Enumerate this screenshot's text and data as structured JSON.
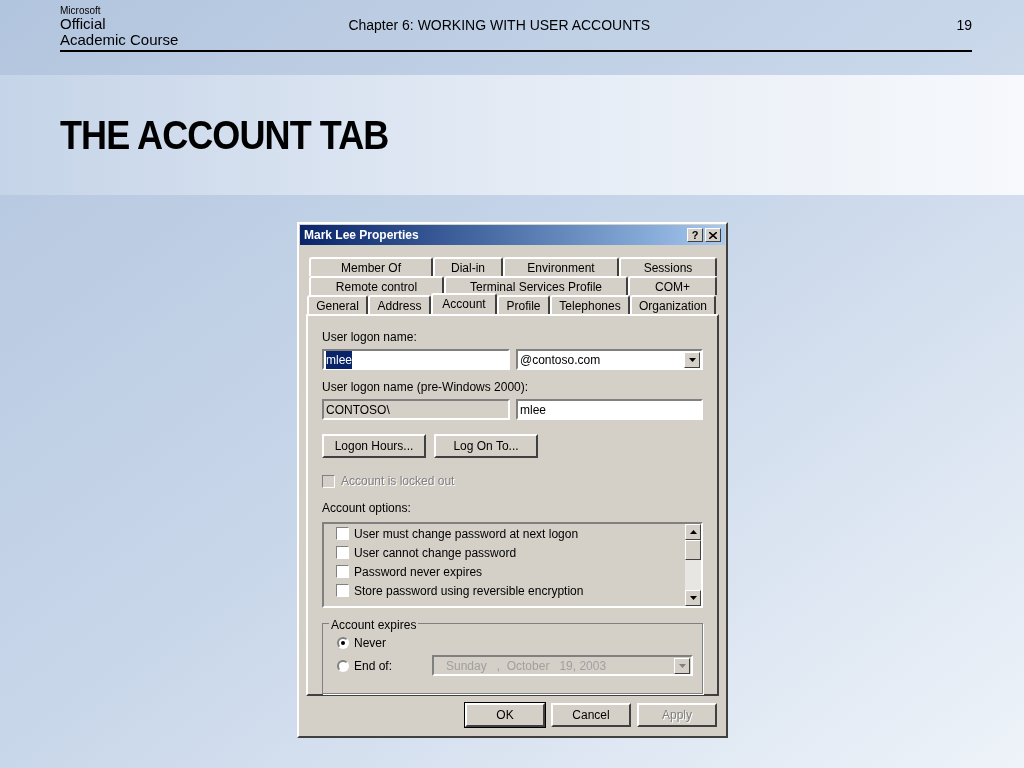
{
  "slide": {
    "logo": {
      "brand": "Microsoft",
      "line1": "Official",
      "line2": "Academic Course"
    },
    "header": "Chapter 6: WORKING WITH USER ACCOUNTS",
    "page": "19",
    "title": "THE ACCOUNT TAB"
  },
  "dialog": {
    "title": "Mark Lee Properties",
    "help": "?",
    "tab_rows": [
      [
        {
          "label": "Member Of",
          "selected": false
        },
        {
          "label": "Dial-in",
          "selected": false
        },
        {
          "label": "Environment",
          "selected": false
        },
        {
          "label": "Sessions",
          "selected": false
        }
      ],
      [
        {
          "label": "Remote control",
          "selected": false
        },
        {
          "label": "Terminal Services Profile",
          "selected": false
        },
        {
          "label": "COM+",
          "selected": false
        }
      ],
      [
        {
          "label": "General",
          "selected": false
        },
        {
          "label": "Address",
          "selected": false
        },
        {
          "label": "Account",
          "selected": true
        },
        {
          "label": "Profile",
          "selected": false
        },
        {
          "label": "Telephones",
          "selected": false
        },
        {
          "label": "Organization",
          "selected": false
        }
      ]
    ],
    "logon_name": {
      "label": "User logon name:",
      "value": "mlee",
      "text_selected": true,
      "domain": "@contoso.com"
    },
    "pre2000": {
      "label": "User logon name (pre-Windows 2000):",
      "domain": "CONTOSO\\",
      "value": "mlee"
    },
    "buttons": [
      "Logon Hours...",
      "Log On To..."
    ],
    "locked_out": {
      "label": "Account is locked out",
      "checked": false,
      "disabled": true
    },
    "options": {
      "label": "Account options:",
      "items": [
        {
          "label": "User must change password at next logon",
          "checked": false
        },
        {
          "label": "User cannot change password",
          "checked": false
        },
        {
          "label": "Password never expires",
          "checked": false
        },
        {
          "label": "Store password using reversible encryption",
          "checked": false
        }
      ]
    },
    "expires": {
      "label": "Account expires",
      "choices": [
        {
          "label": "Never",
          "selected": true
        },
        {
          "label": "End of:",
          "selected": false
        }
      ],
      "date": "Sunday   ,  October   19, 2003",
      "date_disabled": true
    },
    "footer_buttons": [
      {
        "label": "OK",
        "default": true,
        "disabled": false
      },
      {
        "label": "Cancel",
        "default": false,
        "disabled": false
      },
      {
        "label": "Apply",
        "default": false,
        "disabled": true
      }
    ]
  }
}
